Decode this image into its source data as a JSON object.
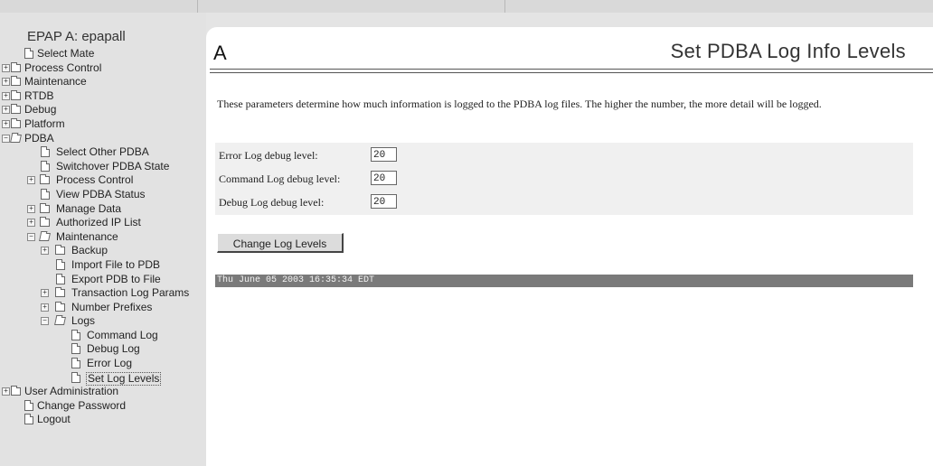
{
  "app": {
    "title": "EPAP A: epapall"
  },
  "sidebar": {
    "items": [
      {
        "label": "Select Mate"
      },
      {
        "label": "Process Control"
      },
      {
        "label": "Maintenance"
      },
      {
        "label": "RTDB"
      },
      {
        "label": "Debug"
      },
      {
        "label": "Platform"
      },
      {
        "label": "PDBA"
      },
      {
        "label": "Select Other PDBA"
      },
      {
        "label": "Switchover PDBA State"
      },
      {
        "label": "Process Control"
      },
      {
        "label": "View PDBA Status"
      },
      {
        "label": "Manage Data"
      },
      {
        "label": "Authorized IP List"
      },
      {
        "label": "Maintenance"
      },
      {
        "label": "Backup"
      },
      {
        "label": "Import File to PDB"
      },
      {
        "label": "Export PDB to File"
      },
      {
        "label": "Transaction Log Params"
      },
      {
        "label": "Number Prefixes"
      },
      {
        "label": "Logs"
      },
      {
        "label": "Command Log"
      },
      {
        "label": "Debug Log"
      },
      {
        "label": "Error Log"
      },
      {
        "label": "Set Log Levels"
      },
      {
        "label": "User Administration"
      },
      {
        "label": "Change Password"
      },
      {
        "label": "Logout"
      }
    ]
  },
  "main": {
    "letter": "A",
    "title": "Set PDBA Log Info Levels",
    "intro": "These parameters determine how much information is logged to the PDBA log files. The higher the number, the more detail will be logged.",
    "params": [
      {
        "label": "Error Log debug level:",
        "value": "20"
      },
      {
        "label": "Command Log debug level:",
        "value": "20"
      },
      {
        "label": "Debug Log debug level:",
        "value": "20"
      }
    ],
    "button_label": "Change Log Levels",
    "status_time": "Thu June 05 2003 16:35:34 EDT"
  }
}
